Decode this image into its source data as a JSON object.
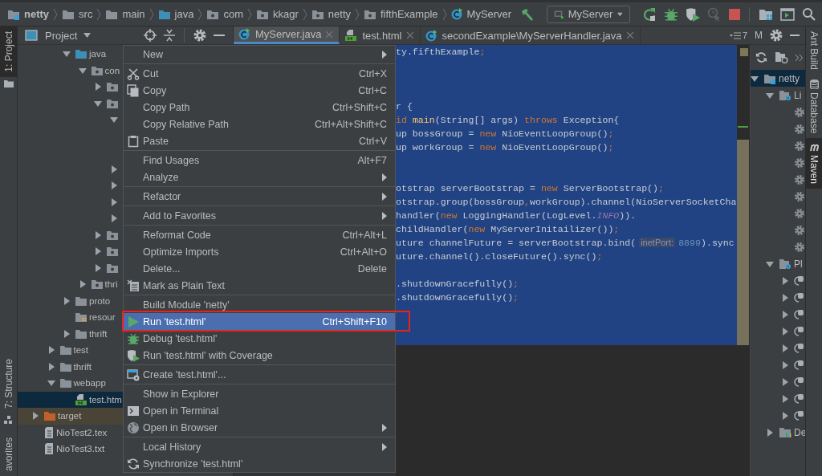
{
  "breadcrumbs": [
    {
      "label": "netty",
      "kind": "module"
    },
    {
      "label": "src",
      "kind": "folder"
    },
    {
      "label": "main",
      "kind": "folder"
    },
    {
      "label": "java",
      "kind": "source"
    },
    {
      "label": "com",
      "kind": "package"
    },
    {
      "label": "kkagr",
      "kind": "package"
    },
    {
      "label": "netty",
      "kind": "package"
    },
    {
      "label": "fifthExample",
      "kind": "package"
    },
    {
      "label": "MyServer",
      "kind": "class"
    }
  ],
  "run_config": {
    "label": "MyServer"
  },
  "left_stripe": [
    {
      "label": "1: Project",
      "selected": true
    },
    {
      "label": "7: Structure",
      "selected": false
    },
    {
      "label": "avorites",
      "selected": false
    }
  ],
  "project_panel": {
    "title": "Project",
    "tree": [
      {
        "children": [
          {
            "children": [
              {
                "label": "java",
                "kind": "source",
                "expanded": true,
                "selected": false,
                "children": [
                  {
                    "label": "con",
                    "kind": "package",
                    "expanded": true,
                    "selected": false,
                    "children": [
                      {
                        "kind": "package",
                        "expanded": false
                      },
                      {
                        "kind": "package",
                        "expanded": true,
                        "children": [
                          {
                            "expanded": true
                          },
                          {
                            "expanded": false
                          },
                          {
                            "expanded": false
                          },
                          {
                            "expanded": false
                          },
                          {
                            "expanded": false
                          }
                        ]
                      },
                      {
                        "kind": "package",
                        "expanded": false
                      },
                      {
                        "kind": "package",
                        "expanded": false
                      },
                      {
                        "kind": "package",
                        "expanded": false
                      }
                    ]
                  },
                  {
                    "label": "thri",
                    "kind": "package",
                    "expanded": false,
                    "selected": false
                  }
                ]
              },
              {
                "label": "proto",
                "kind": "folder",
                "expanded": false,
                "selected": false
              },
              {
                "label": "resour",
                "kind": "resources",
                "selected": false
              },
              {
                "label": "thrift",
                "kind": "folder",
                "expanded": false,
                "selected": false
              }
            ]
          },
          {
            "label": "test",
            "kind": "folder",
            "expanded": false,
            "selected": false
          },
          {
            "label": "thrift",
            "kind": "folder",
            "expanded": false,
            "selected": false
          },
          {
            "label": "webapp",
            "kind": "folder",
            "expanded": true,
            "selected": false,
            "children": [
              {
                "label": "test.htm",
                "kind": "html",
                "selected": true
              }
            ]
          }
        ]
      },
      {
        "label": "target",
        "kind": "excluded",
        "expanded": false,
        "selected": false
      },
      {
        "label": "NioTest2.tex",
        "kind": "text",
        "selected": false
      },
      {
        "label": "NioTest3.txt",
        "kind": "text",
        "selected": false
      }
    ]
  },
  "editor": {
    "tabs": [
      {
        "label": "MyServer.java",
        "kind": "class",
        "selected": true
      },
      {
        "label": "test.html",
        "kind": "html",
        "selected": false
      },
      {
        "label": "secondExample\\MyServerHandler.java",
        "kind": "class",
        "selected": false
      }
    ],
    "tab_count": "7",
    "lines": [
      {
        "selected": true,
        "segments": [
          {
            "text": "ty.fifthExample",
            "kind": "plain"
          },
          {
            "text": ";",
            "kind": "keyword"
          }
        ]
      },
      {
        "selected": true
      },
      {
        "selected": true
      },
      {
        "selected": true
      },
      {
        "selected": true,
        "segments": [
          {
            "text": "r {",
            "kind": "plain"
          }
        ]
      },
      {
        "selected": true,
        "segments": [
          {
            "text": "id ",
            "kind": "keyword"
          },
          {
            "text": "main",
            "kind": "method"
          },
          {
            "text": "(String[] args) ",
            "kind": "plain"
          },
          {
            "text": "throws ",
            "kind": "keyword"
          },
          {
            "text": "Exception{",
            "kind": "plain"
          }
        ]
      },
      {
        "selected": true,
        "segments": [
          {
            "text": "up bossGroup = ",
            "kind": "plain"
          },
          {
            "text": "new ",
            "kind": "keyword"
          },
          {
            "text": "NioEventLoopGroup()",
            "kind": "plain"
          },
          {
            "text": ";",
            "kind": "keyword"
          }
        ]
      },
      {
        "selected": true,
        "segments": [
          {
            "text": "up workGroup = ",
            "kind": "plain"
          },
          {
            "text": "new ",
            "kind": "keyword"
          },
          {
            "text": "NioEventLoopGroup()",
            "kind": "plain"
          },
          {
            "text": ";",
            "kind": "keyword"
          }
        ]
      },
      {
        "selected": true
      },
      {
        "selected": true
      },
      {
        "selected": true,
        "segments": [
          {
            "text": "otstrap serverBootstrap = ",
            "kind": "plain"
          },
          {
            "text": "new ",
            "kind": "keyword"
          },
          {
            "text": "ServerBootstrap()",
            "kind": "plain"
          },
          {
            "text": ";",
            "kind": "keyword"
          }
        ]
      },
      {
        "selected": true,
        "segments": [
          {
            "text": "otstrap.group(bossGroup",
            "kind": "plain"
          },
          {
            "text": ",",
            "kind": "keyword"
          },
          {
            "text": "workGroup).channel(NioServerSocketCha",
            "kind": "plain"
          }
        ]
      },
      {
        "selected": true,
        "segments": [
          {
            "text": "handler(",
            "kind": "plain"
          },
          {
            "text": "new ",
            "kind": "keyword"
          },
          {
            "text": "LoggingHandler(LogLevel.",
            "kind": "plain"
          },
          {
            "text": "INFO",
            "kind": "constant"
          },
          {
            "text": ")).",
            "kind": "plain"
          }
        ]
      },
      {
        "selected": true,
        "segments": [
          {
            "text": "childHandler(",
            "kind": "plain"
          },
          {
            "text": "new ",
            "kind": "keyword"
          },
          {
            "text": "MyServerInitailizer())",
            "kind": "plain"
          },
          {
            "text": ";",
            "kind": "keyword"
          }
        ]
      },
      {
        "selected": true,
        "segments": [
          {
            "text": "uture channelFuture = serverBootstrap.bind(",
            "kind": "plain"
          },
          {
            "text": "inetPort:",
            "kind": "hint"
          },
          {
            "text": "8899",
            "kind": "number"
          },
          {
            "text": ").sync",
            "kind": "plain"
          }
        ]
      },
      {
        "selected": true,
        "segments": [
          {
            "text": "uture.channel().closeFuture().sync()",
            "kind": "plain"
          },
          {
            "text": ";",
            "kind": "keyword"
          }
        ]
      },
      {
        "selected": true
      },
      {
        "selected": true,
        "segments": [
          {
            "text": ".shutdownGracefully()",
            "kind": "plain"
          },
          {
            "text": ";",
            "kind": "keyword"
          }
        ]
      },
      {
        "selected": true,
        "segments": [
          {
            "text": ".shutdownGracefully()",
            "kind": "plain"
          },
          {
            "text": ";",
            "kind": "keyword"
          }
        ]
      },
      {
        "selected": true
      },
      {
        "selected": true
      },
      {
        "selected": true
      },
      {
        "selected": false
      }
    ]
  },
  "context_menu": {
    "groups": [
      [
        {
          "label": "New",
          "submenu": true,
          "selected": false
        }
      ],
      [
        {
          "label": "Cut",
          "shortcut": "Ctrl+X",
          "selected": false
        },
        {
          "label": "Copy",
          "shortcut": "Ctrl+C",
          "selected": false
        },
        {
          "label": "Copy Path",
          "shortcut": "Ctrl+Shift+C",
          "selected": false
        },
        {
          "label": "Copy Relative Path",
          "shortcut": "Ctrl+Alt+Shift+C",
          "selected": false
        },
        {
          "label": "Paste",
          "shortcut": "Ctrl+V",
          "selected": false
        }
      ],
      [
        {
          "label": "Find Usages",
          "shortcut": "Alt+F7",
          "selected": false
        },
        {
          "label": "Analyze",
          "submenu": true,
          "selected": false
        }
      ],
      [
        {
          "label": "Refactor",
          "submenu": true,
          "selected": false
        }
      ],
      [
        {
          "label": "Add to Favorites",
          "submenu": true,
          "selected": false
        }
      ],
      [
        {
          "label": "Reformat Code",
          "shortcut": "Ctrl+Alt+L",
          "selected": false
        },
        {
          "label": "Optimize Imports",
          "shortcut": "Ctrl+Alt+O",
          "selected": false
        },
        {
          "label": "Delete...",
          "shortcut": "Delete",
          "selected": false
        },
        {
          "label": "Mark as Plain Text",
          "selected": false
        }
      ],
      [
        {
          "label": "Build Module 'netty'",
          "selected": false
        },
        {
          "label": "Run 'test.html'",
          "shortcut": "Ctrl+Shift+F10",
          "selected": true
        },
        {
          "label": "Debug 'test.html'",
          "selected": false
        },
        {
          "label": "Run 'test.html' with Coverage",
          "selected": false
        }
      ],
      [
        {
          "label": "Create 'test.html'...",
          "selected": false
        }
      ],
      [
        {
          "label": "Show in Explorer",
          "selected": false
        },
        {
          "label": "Open in Terminal",
          "selected": false
        },
        {
          "label": "Open in Browser",
          "submenu": true,
          "selected": false
        }
      ],
      [
        {
          "label": "Local History",
          "submenu": true,
          "selected": false
        },
        {
          "label": "Synchronize 'test.html'",
          "selected": false
        }
      ]
    ]
  },
  "maven_panel": {
    "title": "M",
    "tree": [
      {
        "label": "netty",
        "kind": "module",
        "expanded": true,
        "selected": true,
        "children": [
          {
            "label": "Li",
            "kind": "lifecycle",
            "expanded": true,
            "selected": false,
            "children": [
              {
                "kind": "goal"
              },
              {
                "kind": "goal"
              },
              {
                "kind": "goal"
              },
              {
                "kind": "goal"
              },
              {
                "kind": "goal"
              },
              {
                "kind": "goal"
              },
              {
                "kind": "goal"
              },
              {
                "kind": "goal"
              },
              {
                "kind": "goal"
              }
            ]
          },
          {
            "label": "Pl",
            "kind": "plugins",
            "expanded": true,
            "selected": false,
            "children": [
              {
                "kind": "plugin",
                "expanded": false
              },
              {
                "kind": "plugin",
                "expanded": false
              },
              {
                "kind": "plugin",
                "expanded": false
              },
              {
                "kind": "plugin",
                "expanded": false
              },
              {
                "kind": "plugin",
                "expanded": false
              },
              {
                "kind": "plugin",
                "expanded": false
              },
              {
                "kind": "plugin",
                "expanded": false
              },
              {
                "kind": "plugin",
                "expanded": false
              },
              {
                "kind": "plugin",
                "expanded": false
              }
            ]
          },
          {
            "label": "De",
            "kind": "dependencies",
            "expanded": false,
            "selected": false
          }
        ]
      }
    ]
  },
  "right_stripe": [
    {
      "label": "Ant Build",
      "selected": false
    },
    {
      "label": "Database",
      "selected": false
    },
    {
      "label": "Maven",
      "selected": true
    }
  ]
}
